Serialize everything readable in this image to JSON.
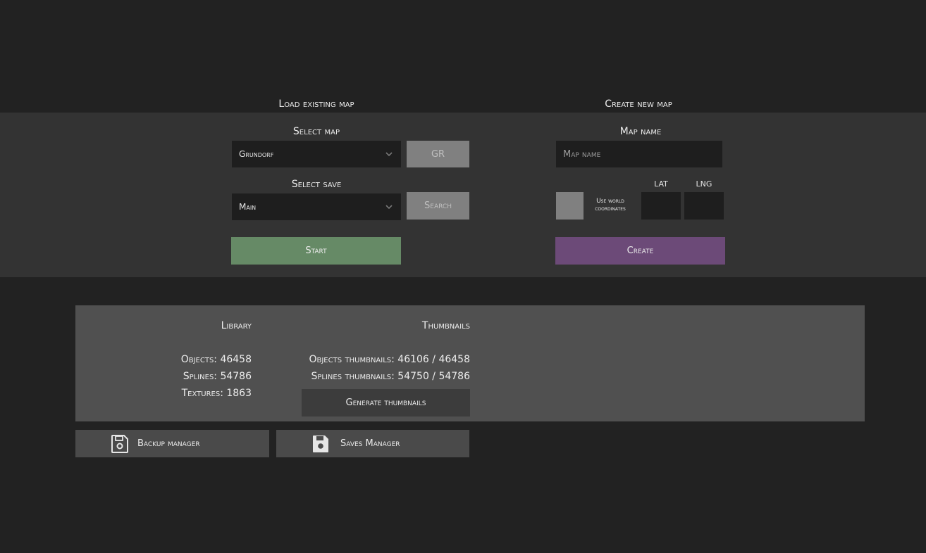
{
  "load_section": {
    "title": "Load existing map",
    "select_map_label": "Select map",
    "selected_map": "Grundorf",
    "map_code_button": "GR",
    "select_save_label": "Select save",
    "selected_save": "Main",
    "search_button": "Search",
    "start_button": "Start"
  },
  "create_section": {
    "title": "Create new map",
    "map_name_label": "Map name",
    "map_name_placeholder": "Map name",
    "map_name_value": "",
    "use_world_coordinates_label": "Use world coordinates",
    "lat_label": "LAT",
    "lng_label": "LNG",
    "lat_value": "",
    "lng_value": "",
    "create_button": "Create"
  },
  "library": {
    "title": "Library",
    "objects": "Objects: 46458",
    "splines": "Splines: 54786",
    "textures": "Textures: 1863"
  },
  "thumbnails": {
    "title": "Thumbnails",
    "objects_thumbnails": "Objects thumbnails: 46106 / 46458",
    "splines_thumbnails": "Splines thumbnails: 54750 / 54786",
    "generate_button": "Generate thumbnails"
  },
  "bottom_buttons": {
    "backup_manager": "Backup manager",
    "saves_manager": "Saves Manager"
  },
  "icons": {
    "backup": "floppy-outline-icon",
    "saves": "floppy-filled-icon",
    "dropdown": "chevron-down-icon"
  },
  "colors": {
    "background": "#222222",
    "panel": "#333333",
    "library_panel": "#505050",
    "start_button": "#668a66",
    "create_button": "#6c4a78",
    "gray_button": "#808080"
  }
}
